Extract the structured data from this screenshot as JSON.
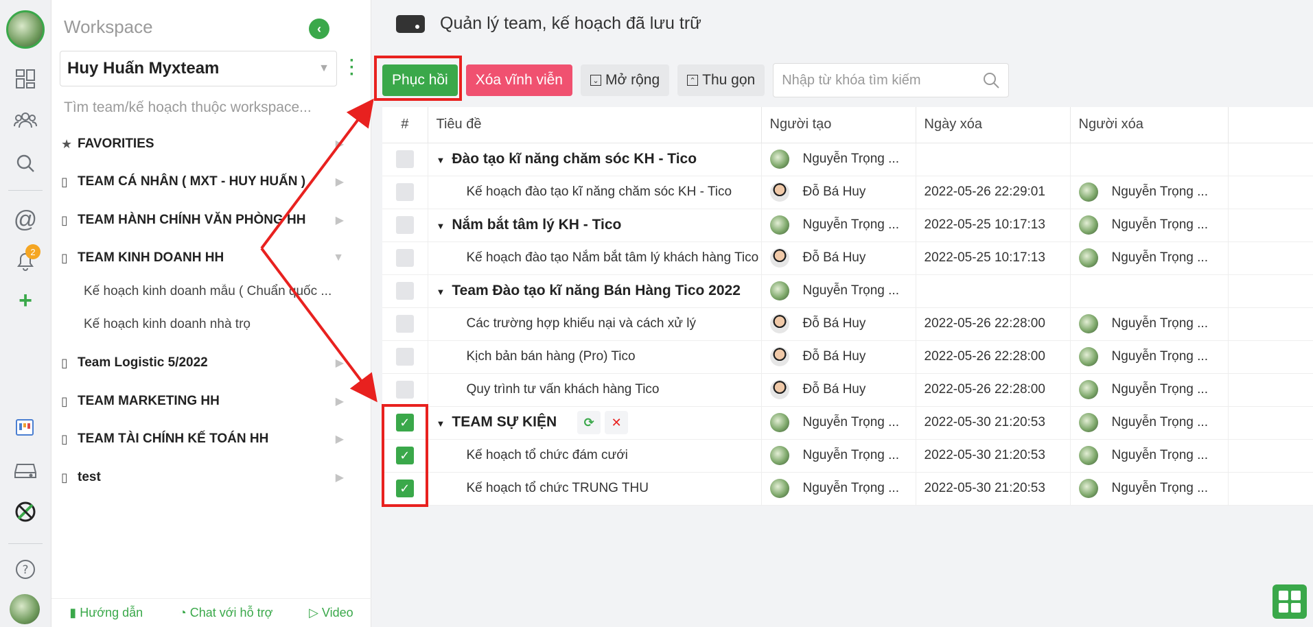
{
  "rail": {
    "icons": [
      "dashboard-icon",
      "team-icon",
      "search-icon",
      "mention-icon",
      "bell-icon",
      "add-icon",
      "board-icon",
      "archive-icon",
      "logo-icon",
      "help-icon"
    ],
    "notification_count": "2"
  },
  "sidebar": {
    "workspace_title": "Workspace",
    "workspace_name": "Huy Huấn Myxteam",
    "search_placeholder": "Tìm team/kế hoạch thuộc workspace...",
    "favorites_label": "FAVORITIES",
    "items": [
      {
        "label": "TEAM CÁ NHÂN ( MXT - HUY HUẤN )"
      },
      {
        "label": "TEAM HÀNH CHÍNH VĂN PHÒNG HH"
      },
      {
        "label": "TEAM KINH DOANH HH"
      },
      {
        "label": "Team Logistic 5/2022"
      },
      {
        "label": "TEAM MARKETING HH"
      },
      {
        "label": "TEAM TÀI CHÍNH KẾ TOÁN HH"
      },
      {
        "label": "test"
      }
    ],
    "sub_items": [
      {
        "label": "Kế hoạch kinh doanh mẫu ( Chuẩn quốc ..."
      },
      {
        "label": "Kế hoạch kinh doanh nhà trọ"
      }
    ],
    "footer": {
      "guide": "Hướng dẫn",
      "chat": "Chat với hỗ trợ",
      "video": "Video"
    }
  },
  "header": {
    "title": "Quản lý team, kế hoạch đã lưu trữ"
  },
  "toolbar": {
    "restore": "Phục hồi",
    "delete_forever": "Xóa vĩnh viễn",
    "expand": "Mở rộng",
    "collapse": "Thu gọn",
    "search_placeholder": "Nhập từ khóa tìm kiếm"
  },
  "table": {
    "columns": [
      "#",
      "Tiêu đề",
      "Người tạo",
      "Ngày xóa",
      "Người xóa"
    ],
    "rows": [
      {
        "type": "group",
        "checked": false,
        "title": "Đào tạo kĩ năng chăm sóc KH - Tico",
        "creator": "Nguyễn Trọng ...",
        "creator_avatar": "green",
        "deleted_at": "",
        "deleter": ""
      },
      {
        "type": "item",
        "checked": false,
        "title": "Kế hoạch đào tạo kĩ năng chăm sóc KH - Tico",
        "creator": "Đỗ Bá Huy",
        "creator_avatar": "face",
        "deleted_at": "2022-05-26 22:29:01",
        "deleter": "Nguyễn Trọng ..."
      },
      {
        "type": "group",
        "checked": false,
        "title": "Nắm bắt tâm lý KH - Tico",
        "creator": "Nguyễn Trọng ...",
        "creator_avatar": "green",
        "deleted_at": "2022-05-25 10:17:13",
        "deleter": "Nguyễn Trọng ..."
      },
      {
        "type": "item",
        "checked": false,
        "title": "Kế hoạch đào tạo Nắm bắt tâm lý khách hàng Tico",
        "creator": "Đỗ Bá Huy",
        "creator_avatar": "face",
        "deleted_at": "2022-05-25 10:17:13",
        "deleter": "Nguyễn Trọng ..."
      },
      {
        "type": "group",
        "checked": false,
        "title": "Team Đào tạo kĩ năng Bán Hàng Tico 2022",
        "creator": "Nguyễn Trọng ...",
        "creator_avatar": "green",
        "deleted_at": "",
        "deleter": ""
      },
      {
        "type": "item",
        "checked": false,
        "title": "Các trường hợp khiếu nại và cách xử lý",
        "creator": "Đỗ Bá Huy",
        "creator_avatar": "face",
        "deleted_at": "2022-05-26 22:28:00",
        "deleter": "Nguyễn Trọng ..."
      },
      {
        "type": "item",
        "checked": false,
        "title": "Kịch bản bán hàng (Pro) Tico",
        "creator": "Đỗ Bá Huy",
        "creator_avatar": "face",
        "deleted_at": "2022-05-26 22:28:00",
        "deleter": "Nguyễn Trọng ..."
      },
      {
        "type": "item",
        "checked": false,
        "title": "Quy trình tư vấn khách hàng Tico",
        "creator": "Đỗ Bá Huy",
        "creator_avatar": "face",
        "deleted_at": "2022-05-26 22:28:00",
        "deleter": "Nguyễn Trọng ..."
      },
      {
        "type": "group",
        "checked": true,
        "title": "TEAM SỰ KIỆN",
        "creator": "Nguyễn Trọng ...",
        "creator_avatar": "green",
        "deleted_at": "2022-05-30 21:20:53",
        "deleter": "Nguyễn Trọng ...",
        "has_actions": true
      },
      {
        "type": "item",
        "checked": true,
        "title": "Kế hoạch tổ chức đám cưới",
        "creator": "Nguyễn Trọng ...",
        "creator_avatar": "green",
        "deleted_at": "2022-05-30 21:20:53",
        "deleter": "Nguyễn Trọng ..."
      },
      {
        "type": "item",
        "checked": true,
        "title": "Kế hoạch tổ chức TRUNG THU",
        "creator": "Nguyễn Trọng ...",
        "creator_avatar": "green",
        "deleted_at": "2022-05-30 21:20:53",
        "deleter": "Nguyễn Trọng ..."
      }
    ]
  },
  "colors": {
    "accent": "#3aa84a",
    "danger": "#f05170",
    "annotation": "#e8211f"
  }
}
